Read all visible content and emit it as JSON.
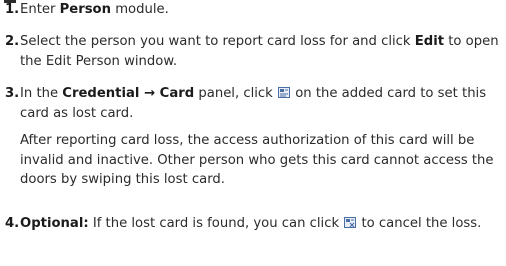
{
  "steps": [
    {
      "number": "1.",
      "pre": "Enter ",
      "bold1": "Person",
      "post": " module."
    },
    {
      "number": "2.",
      "pre": "Select the person you want to report card loss for and click ",
      "bold1": "Edit",
      "post": " to open the Edit Person window."
    },
    {
      "number": "3.",
      "pre": "In the ",
      "bold1": "Credential → Card",
      "mid": " panel, click ",
      "icon": "report-loss-icon",
      "post": " on the added card to set this card as lost card.",
      "note": "After reporting card loss, the access authorization of this card will be invalid and inactive. Other person who gets this card cannot access the doors by swiping this lost card."
    },
    {
      "number": "4.",
      "bold1": "Optional:",
      "mid": " If the lost card is found, you can click ",
      "icon": "cancel-loss-icon",
      "post": " to cancel the loss."
    }
  ],
  "colors": {
    "text": "#2b2b2b",
    "icon_blue": "#4a6fa5"
  }
}
